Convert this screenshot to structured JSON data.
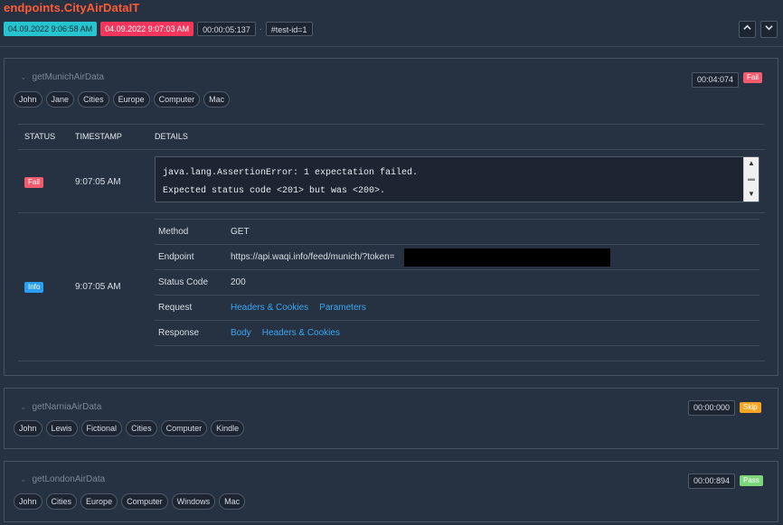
{
  "header": {
    "title": "endpoints.CityAirDataIT",
    "start_time": "04.09.2022 9:06:58 AM",
    "end_time": "04.09.2022 9:07:03 AM",
    "duration": "00:00:05:137",
    "separator": "·",
    "test_id": "#test-id=1",
    "nav_up_icon": "chevron-up-icon",
    "nav_down_icon": "chevron-down-icon"
  },
  "tests": [
    {
      "name": "getMunichAirData",
      "duration": "00:04:074",
      "status": "Fail",
      "tags": [
        "John",
        "Jane",
        "Cities",
        "Europe",
        "Computer",
        "Mac"
      ],
      "table": {
        "headers": [
          "STATUS",
          "TIMESTAMP",
          "DETAILS"
        ],
        "rows": [
          {
            "status": "Fail",
            "timestamp": "9:07:05 AM",
            "detail_line1": "java.lang.AssertionError: 1 expectation failed.",
            "detail_line2": "Expected status code <201> but was <200>."
          },
          {
            "status": "Info",
            "timestamp": "9:07:05 AM",
            "details": {
              "method_label": "Method",
              "method_value": "GET",
              "endpoint_label": "Endpoint",
              "endpoint_value": "https://api.waqi.info/feed/munich/?token=",
              "status_code_label": "Status Code",
              "status_code_value": "200",
              "request_label": "Request",
              "request_link1": "Headers & Cookies",
              "request_link2": "Parameters",
              "response_label": "Response",
              "response_link1": "Body",
              "response_link2": "Headers & Cookies"
            }
          }
        ]
      }
    },
    {
      "name": "getNarniaAirData",
      "duration": "00:00:000",
      "status": "Skip",
      "tags": [
        "John",
        "Lewis",
        "Fictional",
        "Cities",
        "Computer",
        "Kindle"
      ]
    },
    {
      "name": "getLondonAirData",
      "duration": "00:00:894",
      "status": "Pass",
      "tags": [
        "John",
        "Cities",
        "Europe",
        "Computer",
        "Windows",
        "Mac"
      ]
    }
  ],
  "colors": {
    "background": "#263241",
    "title": "#ff5a36",
    "start_badge": "#25c4cf",
    "end_badge": "#f5365c",
    "fail": "#f25c6e",
    "skip": "#f6a623",
    "pass": "#7ed67a",
    "info": "#2a9ff2",
    "link": "#3aa7f3"
  }
}
